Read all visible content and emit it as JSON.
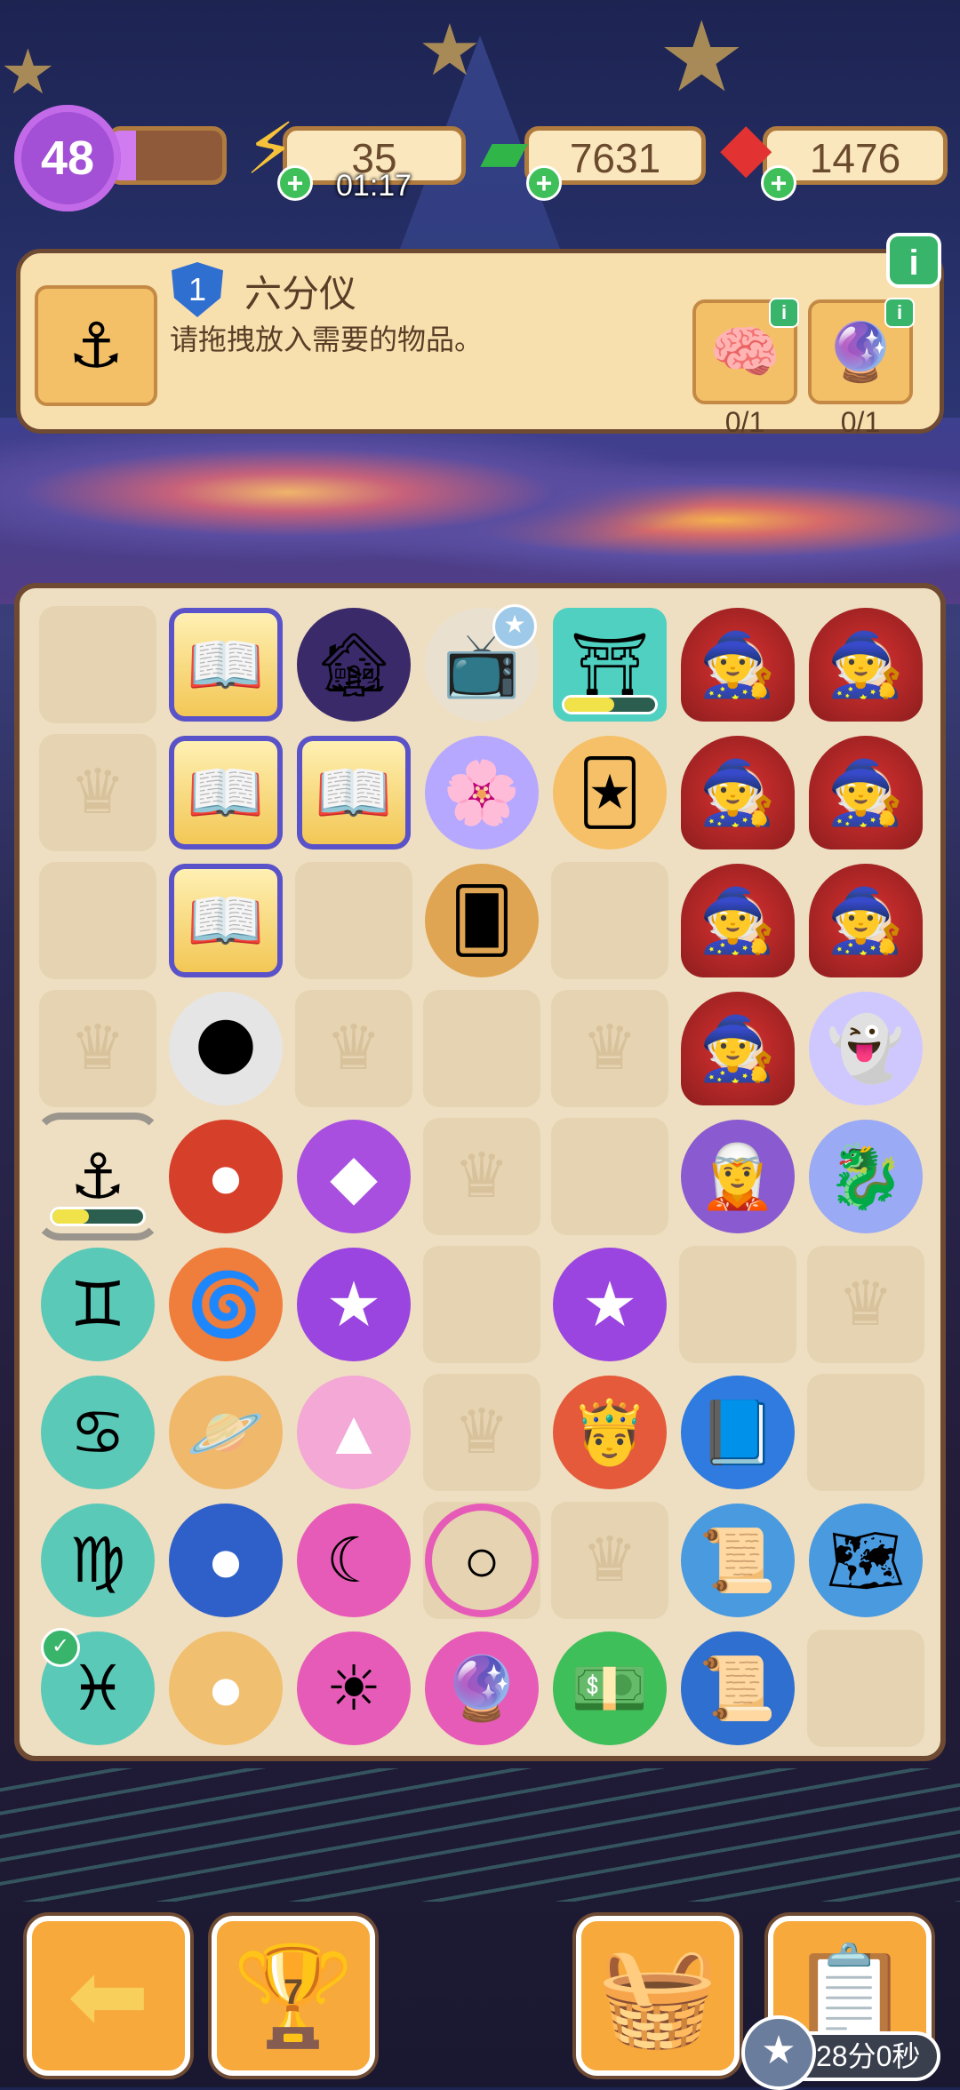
{
  "status_bar": {
    "level": "48",
    "energy": "35",
    "energy_timer": "01:17",
    "cash": "7631",
    "gems": "1476",
    "level_progress": 0.22
  },
  "quest": {
    "level_badge": "1",
    "title": "六分仪",
    "description": "请拖拽放入需要的物品。",
    "requirements": [
      {
        "icon": "brain-icon",
        "count": "0/1"
      },
      {
        "icon": "crystal-ball-icon",
        "count": "0/1"
      }
    ]
  },
  "board": {
    "rows": [
      [
        "empty",
        "book",
        "haunted-house",
        "tv",
        "portal",
        "mage",
        "mage"
      ],
      [
        "crown",
        "book",
        "book",
        "spirit-flower",
        "tarot-cards",
        "mage",
        "mage"
      ],
      [
        "empty",
        "book",
        "empty",
        "tarot-card",
        "empty",
        "mage",
        "mage"
      ],
      [
        "crown",
        "moon",
        "crown",
        "empty",
        "crown",
        "mage",
        "ghost"
      ],
      [
        "sextant",
        "mars",
        "diamond",
        "crown",
        "empty",
        "wizard",
        "dragon"
      ],
      [
        "gemini",
        "swirl-planet",
        "star",
        "empty",
        "star-face",
        "empty",
        "crown"
      ],
      [
        "cancer",
        "saturn",
        "triangle-rune",
        "crown",
        "king",
        "spellbook",
        "empty"
      ],
      [
        "virgo",
        "blue-planet",
        "moon-rune",
        "ring",
        "crown",
        "scroll",
        "map"
      ],
      [
        "pisces",
        "jupiter",
        "sun-moon-rune",
        "crystal-ball",
        "cash",
        "treasure-scroll",
        "empty"
      ]
    ],
    "generator_progress": {
      "portal": 0.55,
      "sextant": 0.4
    }
  },
  "bottom": {
    "trophy_count": "7",
    "event_timer": "28分0秒"
  }
}
